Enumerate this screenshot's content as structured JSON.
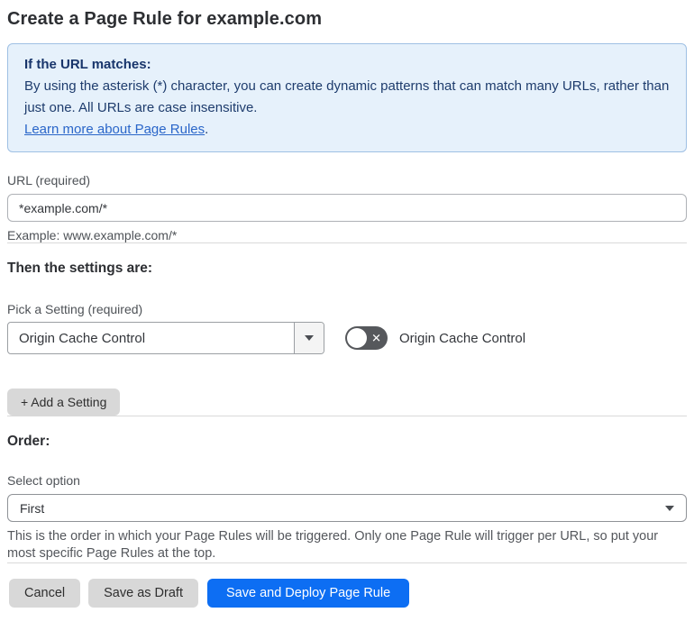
{
  "page": {
    "title": "Create a Page Rule for example.com"
  },
  "info_banner": {
    "heading": "If the URL matches:",
    "body": "By using the asterisk (*) character, you can create dynamic patterns that can match many URLs, rather than just one. All URLs are case insensitive.",
    "link_label": "Learn more about Page Rules",
    "link_suffix": "."
  },
  "url_section": {
    "label": "URL (required)",
    "value": "*example.com/*",
    "example": "Example: www.example.com/*"
  },
  "settings_section": {
    "heading": "Then the settings are:",
    "pick_label": "Pick a Setting (required)",
    "selected_setting": "Origin Cache Control",
    "toggle_label": "Origin Cache Control",
    "toggle_state": "off",
    "toggle_x": "✕",
    "add_setting_label": "+ Add a Setting"
  },
  "order_section": {
    "heading": "Order:",
    "label": "Select option",
    "selected_option": "First",
    "help_text": "This is the order in which your Page Rules will be triggered. Only one Page Rule will trigger per URL, so put your most specific Page Rules at the top."
  },
  "footer": {
    "cancel_label": "Cancel",
    "save_draft_label": "Save as Draft",
    "save_deploy_label": "Save and Deploy Page Rule"
  },
  "colors": {
    "accent_blue": "#0d6ef3",
    "info_bg": "#e6f1fb",
    "info_border": "#9fc0e4",
    "info_text": "#1e3c6d",
    "link_blue": "#2a66c9",
    "toggle_off_bg": "#56585c",
    "button_gray": "#d8d8d8"
  }
}
